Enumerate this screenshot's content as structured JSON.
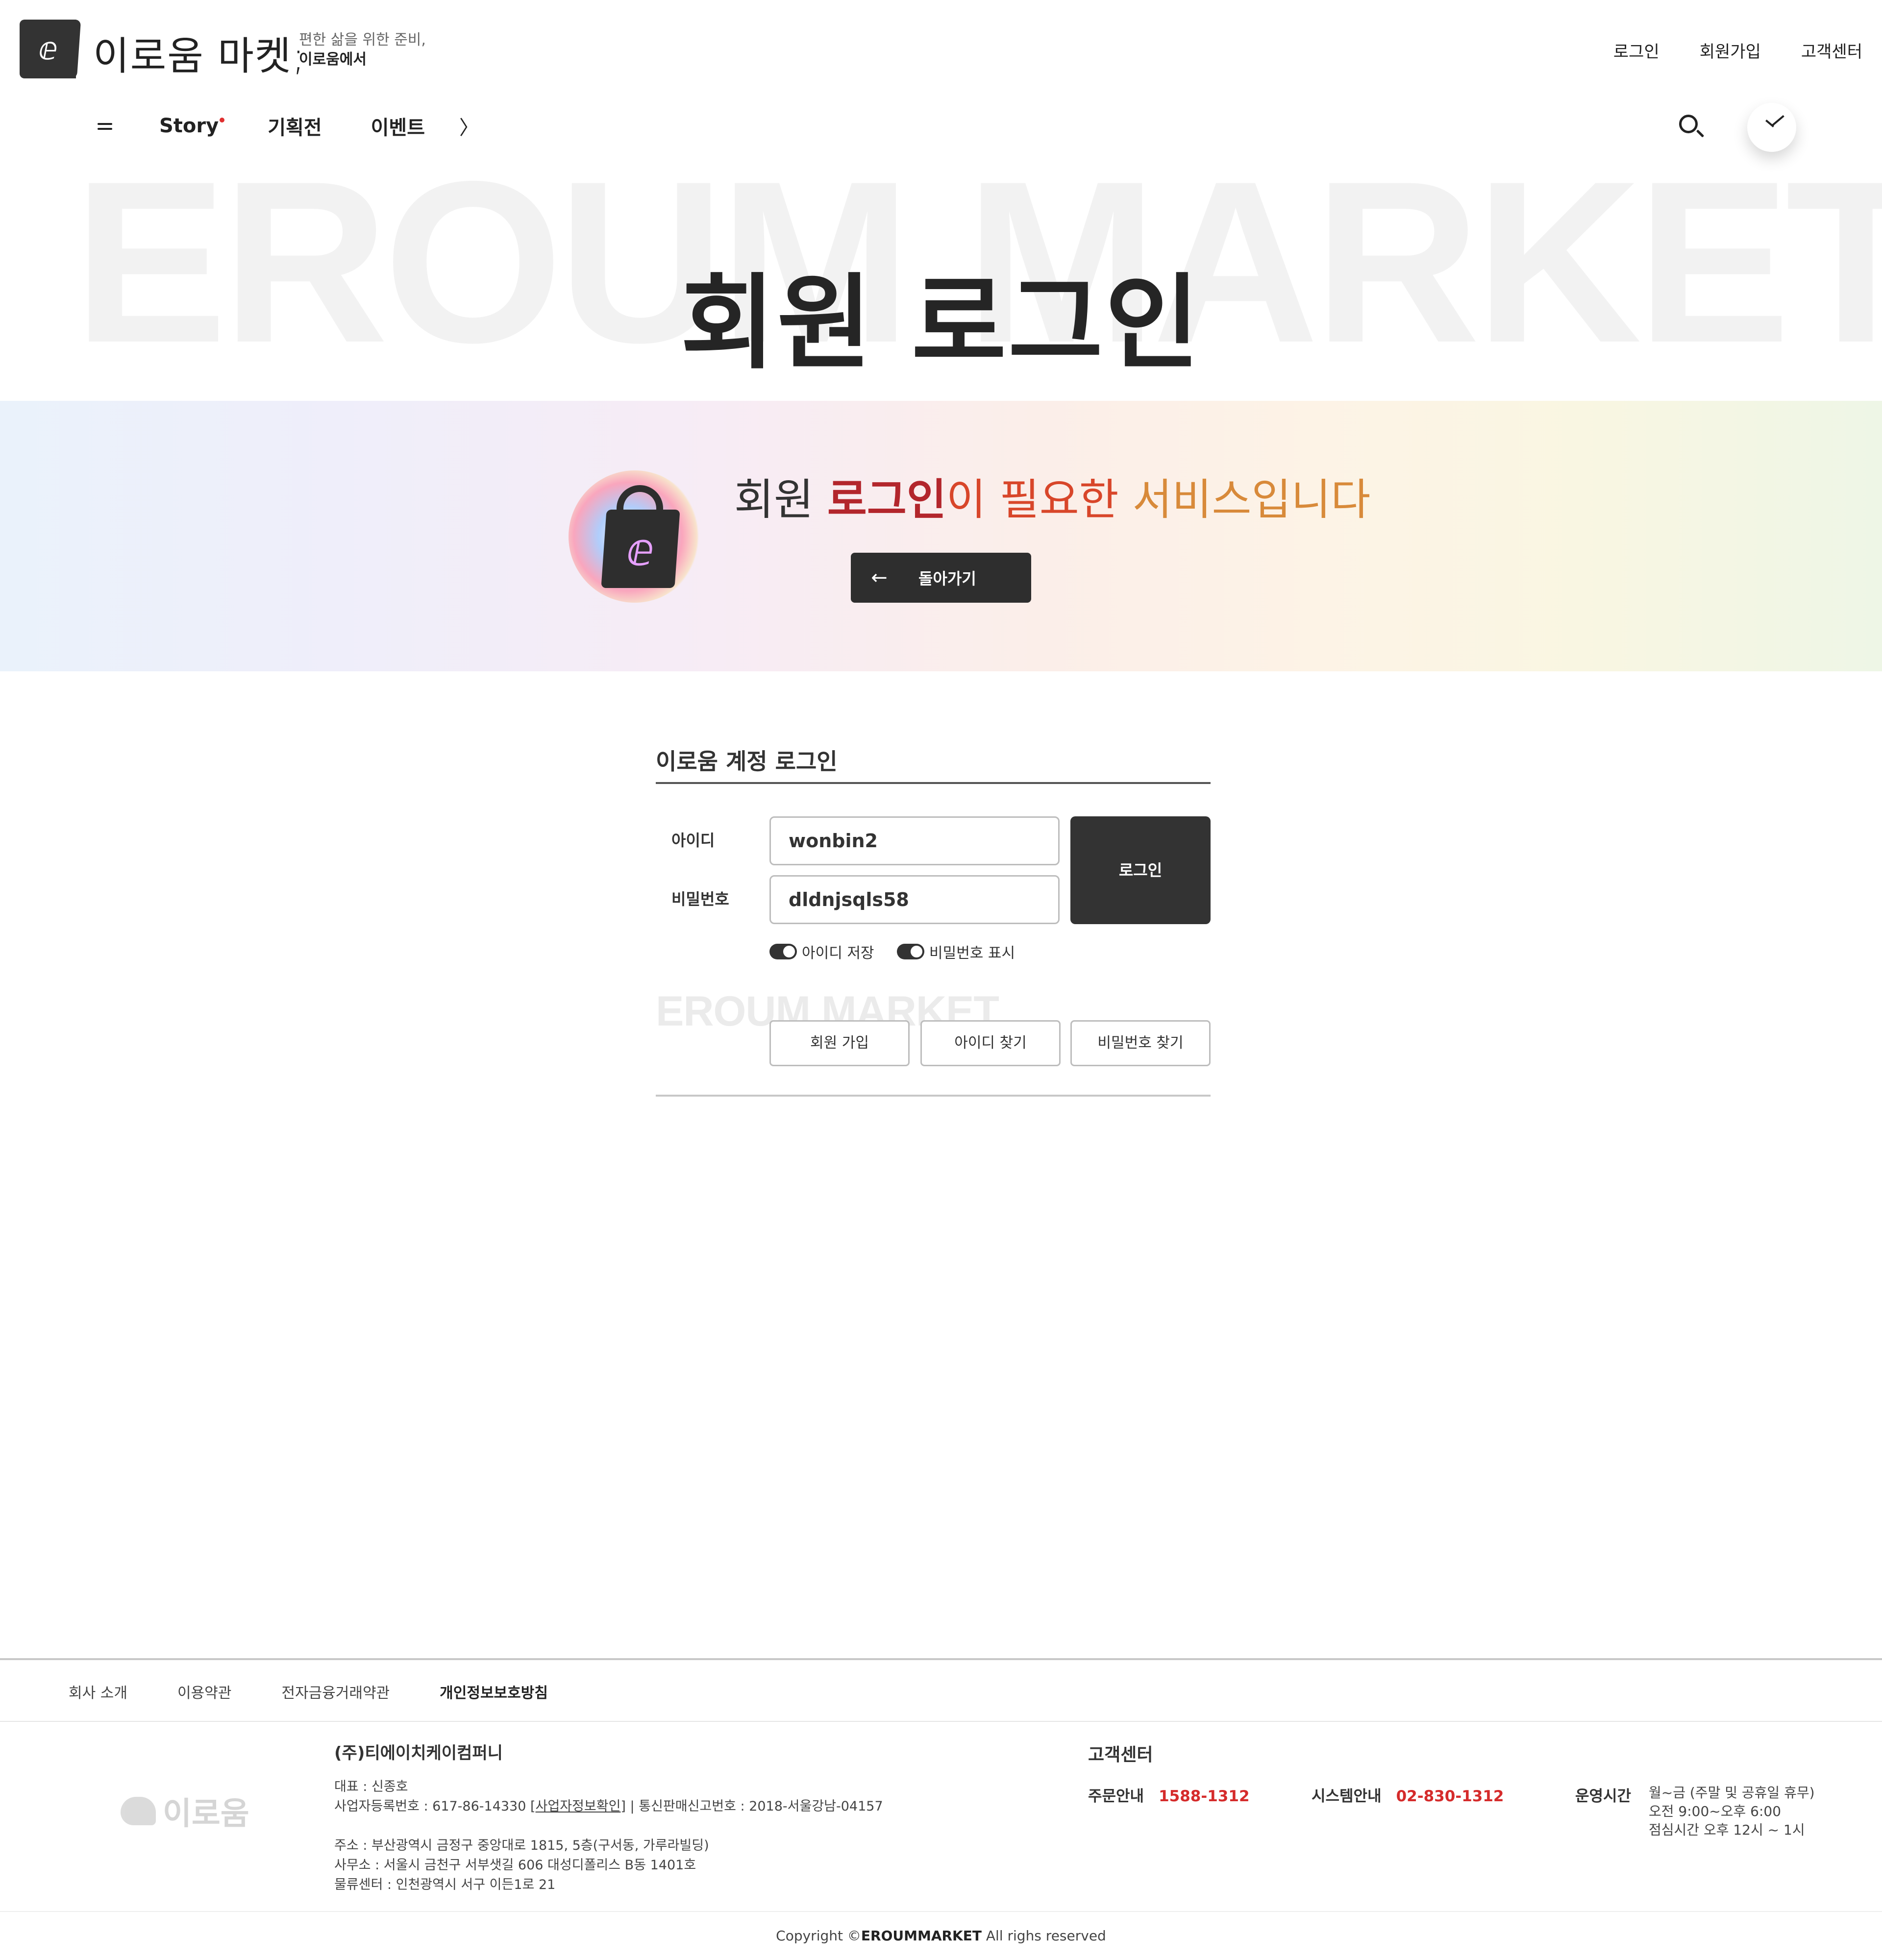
{
  "header": {
    "brand": "이로움 마켓;",
    "tagline_line1": "편한 삶을 위한 준비,",
    "tagline_line2": "이로움에서",
    "util_nav": [
      "로그인",
      "회원가입",
      "고객센터"
    ],
    "gnb": [
      "Story",
      "기획전",
      "이벤트"
    ],
    "gnb_more": "〉",
    "logo_glyph": "ⅇ"
  },
  "hero": {
    "watermark": "EROUM MARKET",
    "title": "회원 로그인"
  },
  "banner": {
    "text_part1": "회원 ",
    "text_part2": "로그인",
    "text_part3": "이 필요한 ",
    "text_part4": "서비스입니다",
    "back_label": "돌아가기",
    "back_arrow": "←",
    "bag_glyph": "ⅇ"
  },
  "login": {
    "title": "이로움 계정 로그인",
    "id_label": "아이디",
    "id_value": "wonbin2",
    "pw_label": "비밀번호",
    "pw_value": "dldnjsqls58",
    "submit_label": "로그인",
    "save_id_label": "아이디 저장",
    "show_pw_label": "비밀번호 표시",
    "watermark": "EROUM MARKET",
    "signup_label": "회원 가입",
    "find_id_label": "아이디 찾기",
    "find_pw_label": "비밀번호 찾기"
  },
  "footer": {
    "nav": [
      "회사 소개",
      "이용약관",
      "전자금융거래약관",
      "개인정보보호방침"
    ],
    "logo_text": "이로움",
    "company_name": "(주)티에이치케이컴퍼니",
    "ceo": "대표 : 신종호",
    "biz_reg_prefix": "사업자등록번호 : 617-86-14330 ",
    "biz_reg_link": "[사업자정보확인]",
    "biz_reg_suffix": "  |  통신판매신고번호 : 2018-서울강남-04157",
    "address": "주소 : 부산광역시 금정구 중앙대로 1815, 5층(구서동, 가루라빌딩)",
    "office": "사무소 : 서울시 금천구 서부샛길 606 대성디폴리스 B동 1401호",
    "logistics": "물류센터 : 인천광역시 서구 이든1로 21",
    "cs_title": "고객센터",
    "order_label": "주문안내",
    "order_phone": "1588-1312",
    "system_label": "시스템안내",
    "system_phone": "02-830-1312",
    "hours_label": "운영시간",
    "hours_line1": "월~금 (주말 및 공휴일 휴무)",
    "hours_line2": "오전 9:00~오후 6:00",
    "hours_line3": "점심시간 오후 12시 ~ 1시",
    "copyright_prefix": "Copyright ©",
    "copyright_brand": "EROUMMARKET",
    "copyright_suffix": " All righs reserved"
  },
  "colors": {
    "dark": "#333333",
    "accent_red": "#d52b2b",
    "banner_red": "#b3262c",
    "banner_orange": "#d88a3a"
  }
}
